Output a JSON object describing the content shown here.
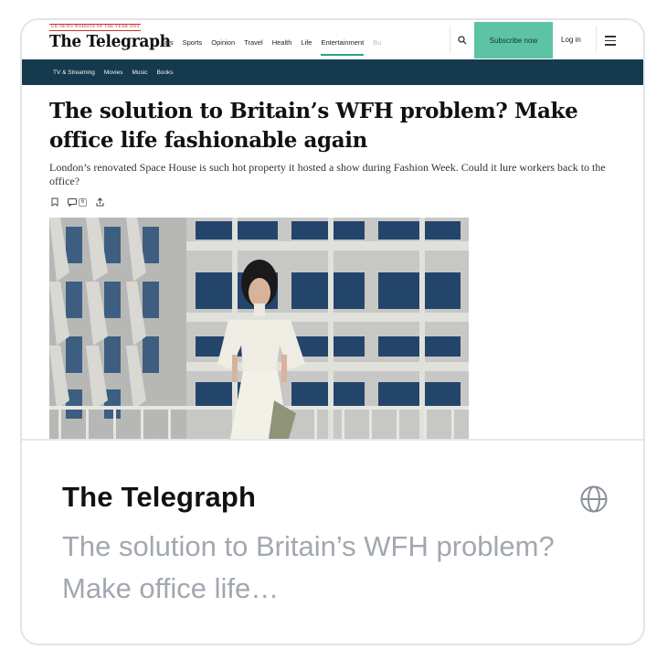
{
  "preview": {
    "badge": "UK NEWS WEBSITE OF THE YEAR 2024",
    "logo": "The Telegraph",
    "nav": [
      "als",
      "Sports",
      "Opinion",
      "Travel",
      "Health",
      "Life",
      "Entertainment",
      "Bu"
    ],
    "subscribe_label": "Subscribe now",
    "login_label": "Log in",
    "subnav": [
      "TV & Streaming",
      "Movies",
      "Music",
      "Books"
    ],
    "headline": "The solution to Britain’s WFH problem? Make office life fashionable again",
    "standfirst": "London’s renovated Space House is such hot property it hosted a show during Fashion Week. Could it lure workers back to the office?",
    "comment_count": "6",
    "icons": {
      "bookmark": "bookmark-icon",
      "comments": "comment-icon",
      "share": "share-icon",
      "search": "search-icon",
      "menu": "menu-icon"
    }
  },
  "card": {
    "site_name": "The Telegraph",
    "description": "The solution to Britain’s WFH problem? Make office life…",
    "icon": "globe-icon"
  },
  "colors": {
    "accent": "#5cc3a4",
    "subnav_bg": "#163a4d",
    "title": "#111111",
    "description": "#a2a7b0",
    "border": "#e3e4e8"
  }
}
